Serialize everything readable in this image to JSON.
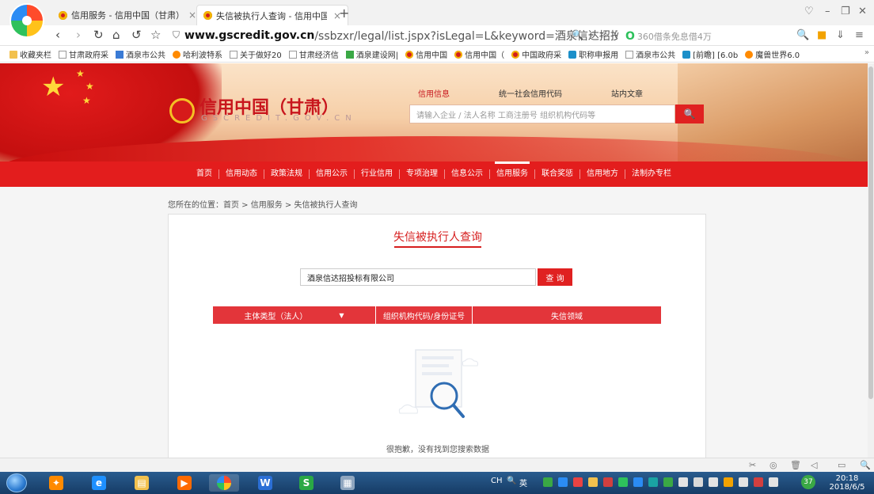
{
  "tabs": [
    {
      "title": "信用服务 - 信用中国（甘肃）"
    },
    {
      "title": "失信被执行人查询 - 信用中国（甘肃）"
    }
  ],
  "address": {
    "host": "www.gscredit.gov.cn",
    "path": "/ssbzxr/legal/list.jspx?isLegal=L&keyword=酒泉信达招投标"
  },
  "nav_ad": "360借条免息借4万",
  "bookmarks": [
    {
      "label": "收藏夹栏",
      "icon": "folder"
    },
    {
      "label": "甘肃政府采",
      "icon": "page"
    },
    {
      "label": "酒泉市公共",
      "icon": "blue"
    },
    {
      "label": "哈利波特系",
      "icon": "orange"
    },
    {
      "label": "关于做好20",
      "icon": "page"
    },
    {
      "label": "甘肃经济信",
      "icon": "page"
    },
    {
      "label": "酒泉建设网|",
      "icon": "green"
    },
    {
      "label": "信用中国",
      "icon": "red"
    },
    {
      "label": "信用中国（",
      "icon": "red"
    },
    {
      "label": "中国政府采",
      "icon": "red"
    },
    {
      "label": "职称申报用",
      "icon": "teal"
    },
    {
      "label": "酒泉市公共",
      "icon": "page"
    },
    {
      "label": "[前瞻] [6.0b",
      "icon": "teal"
    },
    {
      "label": "魔兽世界6.0",
      "icon": "orange"
    }
  ],
  "site": {
    "name": "信用中国（甘肃）",
    "sub": "GSCREDIT.GOV.CN",
    "search_tabs": [
      "信用信息",
      "统一社会信用代码",
      "站内文章"
    ],
    "search_placeholder": "请输入企业 / 法人名称 工商注册号 组织机构代码等"
  },
  "mainnav": [
    "首页",
    "信用动态",
    "政策法规",
    "信用公示",
    "行业信用",
    "专项治理",
    "信息公示",
    "信用服务",
    "联合奖惩",
    "信用地方",
    "法制办专栏"
  ],
  "breadcrumb": "您所在的位置：首页 > 信用服务 > 失信被执行人查询",
  "query": {
    "title": "失信被执行人查询",
    "input_value": "酒泉信达招投标有限公司",
    "button": "查 询",
    "columns": [
      "主体类型（法人）",
      "组织机构代码/身份证号",
      "失信领域"
    ],
    "empty_text": "很抱歉，没有找到您搜索数据"
  },
  "taskbar": {
    "ime": "CH",
    "ime_lang": "英",
    "badge": "37",
    "time": "20:18",
    "date": "2018/6/5"
  },
  "colors": {
    "accent": "#e31d1d",
    "title_red": "#d61e1e"
  }
}
